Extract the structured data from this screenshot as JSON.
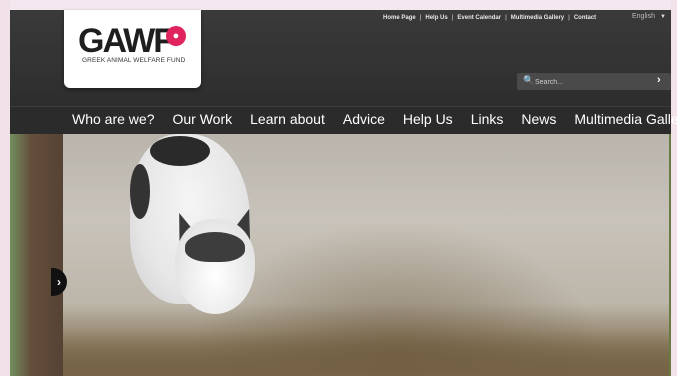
{
  "brand": {
    "logo_text": "GAWF",
    "logo_subtitle": "GREEK ANIMAL WELFARE FUND",
    "paw_icon": "paw-icon",
    "accent_color": "#e0245e"
  },
  "utility_nav": {
    "items": [
      "Home Page",
      "Help Us",
      "Event Calendar",
      "Multimedia Gallery",
      "Contact"
    ],
    "language": "English"
  },
  "search": {
    "placeholder": "Search...",
    "icon": "search-icon",
    "go_icon": "chevron-right-icon"
  },
  "main_nav": {
    "items": [
      "Who are we?",
      "Our Work",
      "Learn about",
      "Advice",
      "Help Us",
      "Links",
      "News",
      "Multimedia Gallery"
    ]
  },
  "hero": {
    "image": "cat drinking water",
    "prev_icon": "chevron-right-icon"
  },
  "colors": {
    "header_bg": "#333333",
    "nav_text": "#ffffff"
  }
}
